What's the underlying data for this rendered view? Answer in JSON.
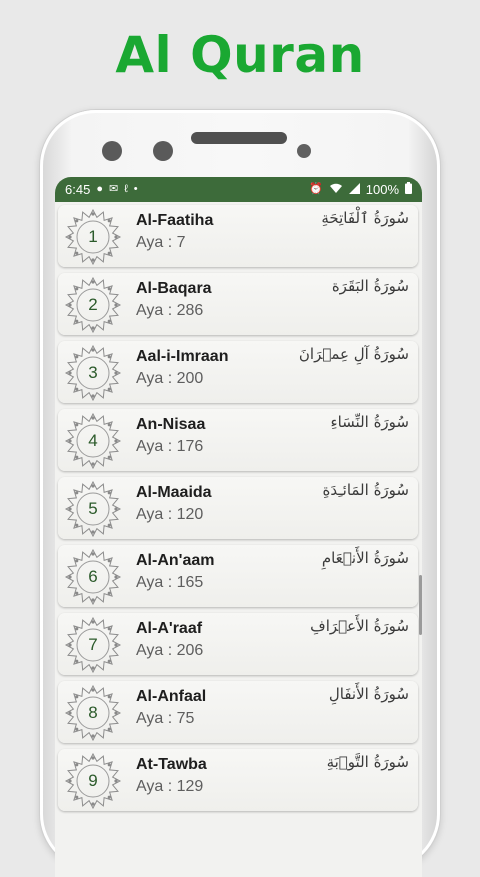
{
  "app": {
    "title": "Al Quran"
  },
  "status_bar": {
    "time": "6:45",
    "battery": "100%",
    "left_icons": [
      "chat-bubble-icon",
      "mail-icon",
      "nfc-icon",
      "dot-icon"
    ],
    "right_icons": [
      "alarm-icon",
      "wifi-icon",
      "signal-icon",
      "battery-icon"
    ]
  },
  "surahs": [
    {
      "number": "1",
      "name": "Al-Faatiha",
      "aya": "Aya : 7",
      "arabic": "سُورَةُ ٱلْفَاتِحَةِ"
    },
    {
      "number": "2",
      "name": "Al-Baqara",
      "aya": "Aya : 286",
      "arabic": "سُورَةُ البَقَرَة"
    },
    {
      "number": "3",
      "name": "Aal-i-Imraan",
      "aya": "Aya : 200",
      "arabic": "سُورَةُ آلِ عِمۡرَانَ"
    },
    {
      "number": "4",
      "name": "An-Nisaa",
      "aya": "Aya : 176",
      "arabic": "سُورَةُ النِّسَاءِ"
    },
    {
      "number": "5",
      "name": "Al-Maaida",
      "aya": "Aya : 120",
      "arabic": "سُورَةُ المَائـِدَةِ"
    },
    {
      "number": "6",
      "name": "Al-An'aam",
      "aya": "Aya : 165",
      "arabic": "سُورَةُ الأَنۡعَامِ"
    },
    {
      "number": "7",
      "name": "Al-A'raaf",
      "aya": "Aya : 206",
      "arabic": "سُورَةُ الأَعۡرَافِ"
    },
    {
      "number": "8",
      "name": "Al-Anfaal",
      "aya": "Aya : 75",
      "arabic": "سُورَةُ الأَنفَالِ"
    },
    {
      "number": "9",
      "name": "At-Tawba",
      "aya": "Aya : 129",
      "arabic": "سُورَةُ التَّوۡبَةِ"
    }
  ],
  "colors": {
    "title_green": "#1aa832",
    "status_bar_green": "#3d6b3a",
    "number_green": "#2b5a2a"
  }
}
